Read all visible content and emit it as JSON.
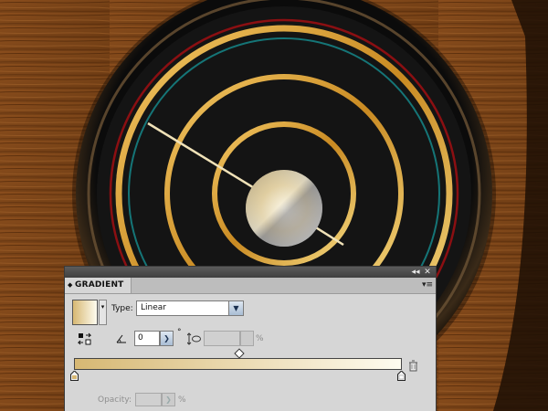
{
  "panel": {
    "tab_title": "GRADIENT",
    "tab_arrows": "◆",
    "collapse_icon": "◂◂",
    "close_icon": "✕",
    "menu_icon": "▾≡",
    "type_label": "Type:",
    "type_value": "Linear",
    "angle_value": "0",
    "degree_symbol": "°",
    "aspect_unit": "%",
    "opacity_label": "Opacity:",
    "opacity_unit": "%",
    "gradient_start_color": "#d7b873",
    "gradient_end_color": "#fefcf0"
  },
  "artwork": {
    "wood_color": "#7a4418",
    "ring_gold": "#e2a83a",
    "ring_red": "#8b0f12",
    "ring_teal": "#157577",
    "dial_face": "#151515"
  }
}
